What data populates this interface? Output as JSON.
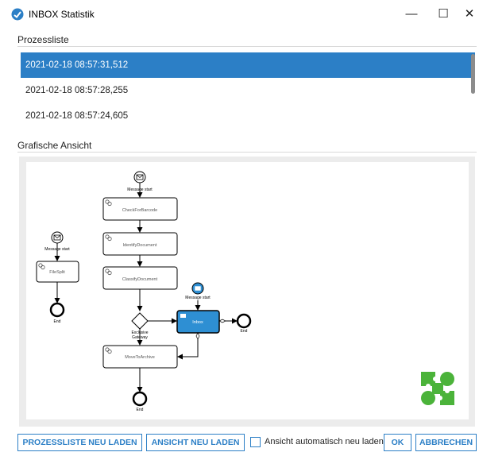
{
  "window": {
    "title": "INBOX Statistik",
    "minimize_symbol": "—",
    "maximize_symbol": "☐",
    "close_symbol": "✕"
  },
  "process_list": {
    "heading": "Prozessliste",
    "items": [
      {
        "label": "2021-02-18 08:57:31,512",
        "selected": true
      },
      {
        "label": "2021-02-18 08:57:28,255",
        "selected": false
      },
      {
        "label": "2021-02-18 08:57:24,605",
        "selected": false
      }
    ]
  },
  "graphic_view": {
    "heading": "Grafische Ansicht",
    "diagram": {
      "left_flow": {
        "start_label": "Message start",
        "task_label": "FileSplit",
        "end_label": "End"
      },
      "main_flow": {
        "start_label": "Message start",
        "tasks": [
          "CheckForBarcode",
          "IdentifyDocument",
          "ClassifyDocument"
        ],
        "gateway_label": "Exclusive Gateway",
        "archive_task": "MoveToArchive",
        "end_label": "End"
      },
      "inbox_flow": {
        "start_label": "Message start",
        "task_label": "Inbox",
        "end_label": "End"
      }
    },
    "logo_icon": "puzzle-logo-icon",
    "colors": {
      "selection": "#2c7fc6",
      "inbox_task": "#2e8fd3",
      "logo": "#4bb33a"
    }
  },
  "footer": {
    "reload_list_button": "PROZESSLISTE NEU LADEN",
    "reload_view_button": "ANSICHT NEU LADEN",
    "auto_reload_label": "Ansicht automatisch neu laden",
    "auto_reload_checked": false,
    "ok_button": "OK",
    "cancel_button": "ABBRECHEN"
  }
}
